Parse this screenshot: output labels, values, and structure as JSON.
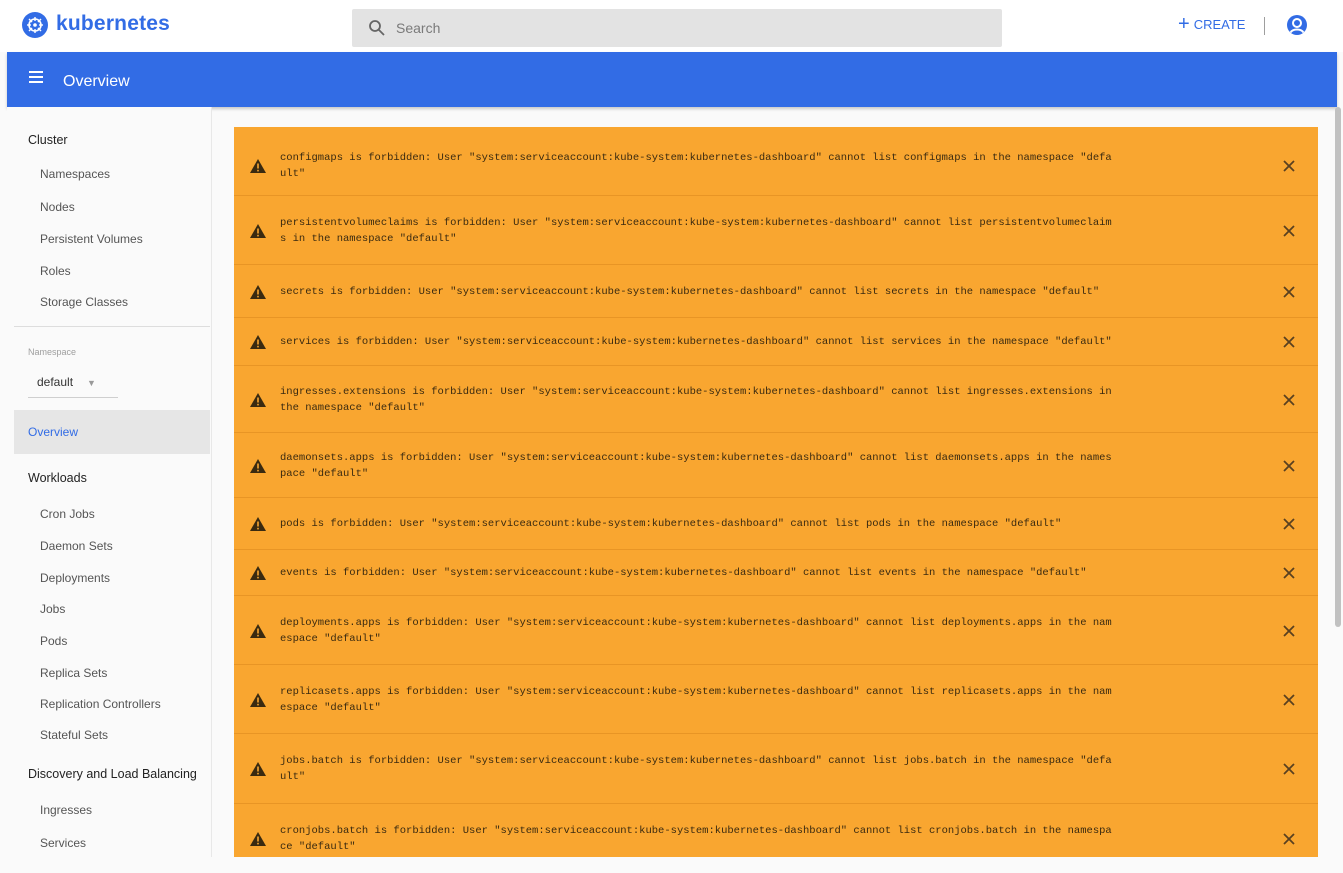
{
  "app": {
    "brand": "kubernetes"
  },
  "header": {
    "search_placeholder": "Search",
    "create_label": "CREATE",
    "plus_glyph": "+"
  },
  "toolbar": {
    "title": "Overview"
  },
  "sidebar": {
    "cluster_heading": "Cluster",
    "cluster_items": [
      "Namespaces",
      "Nodes",
      "Persistent Volumes",
      "Roles",
      "Storage Classes"
    ],
    "namespace_label": "Namespace",
    "namespace_value": "default",
    "overview": "Overview",
    "workloads_heading": "Workloads",
    "workload_items": [
      "Cron Jobs",
      "Daemon Sets",
      "Deployments",
      "Jobs",
      "Pods",
      "Replica Sets",
      "Replication Controllers",
      "Stateful Sets"
    ],
    "discovery_heading": "Discovery and Load Balancing",
    "discovery_items": [
      "Ingresses",
      "Services"
    ]
  },
  "alerts": [
    {
      "lines": [
        "configmaps is forbidden: User \"system:serviceaccount:kube-system:kubernetes-dashboard\" cannot list configmaps in the namespace \"defa",
        "ult\""
      ]
    },
    {
      "lines": [
        "persistentvolumeclaims is forbidden: User \"system:serviceaccount:kube-system:kubernetes-dashboard\" cannot list persistentvolumeclaim",
        "s in the namespace \"default\""
      ]
    },
    {
      "lines": [
        "secrets is forbidden: User \"system:serviceaccount:kube-system:kubernetes-dashboard\" cannot list secrets in the namespace \"default\""
      ]
    },
    {
      "lines": [
        "services is forbidden: User \"system:serviceaccount:kube-system:kubernetes-dashboard\" cannot list services in the namespace \"default\""
      ]
    },
    {
      "lines": [
        "ingresses.extensions is forbidden: User \"system:serviceaccount:kube-system:kubernetes-dashboard\" cannot list ingresses.extensions in",
        "the namespace \"default\""
      ]
    },
    {
      "lines": [
        "daemonsets.apps is forbidden: User \"system:serviceaccount:kube-system:kubernetes-dashboard\" cannot list daemonsets.apps in the names",
        "pace \"default\""
      ]
    },
    {
      "lines": [
        "pods is forbidden: User \"system:serviceaccount:kube-system:kubernetes-dashboard\" cannot list pods in the namespace \"default\""
      ]
    },
    {
      "lines": [
        "events is forbidden: User \"system:serviceaccount:kube-system:kubernetes-dashboard\" cannot list events in the namespace \"default\""
      ]
    },
    {
      "lines": [
        "deployments.apps is forbidden: User \"system:serviceaccount:kube-system:kubernetes-dashboard\" cannot list deployments.apps in the nam",
        "espace \"default\""
      ]
    },
    {
      "lines": [
        "replicasets.apps is forbidden: User \"system:serviceaccount:kube-system:kubernetes-dashboard\" cannot list replicasets.apps in the nam",
        "espace \"default\""
      ]
    },
    {
      "lines": [
        "jobs.batch is forbidden: User \"system:serviceaccount:kube-system:kubernetes-dashboard\" cannot list jobs.batch in the namespace \"defa",
        "ult\""
      ]
    },
    {
      "lines": [
        "cronjobs.batch is forbidden: User \"system:serviceaccount:kube-system:kubernetes-dashboard\" cannot list cronjobs.batch in the namespa",
        "ce \"default\""
      ]
    }
  ],
  "icons": {
    "search": "search-icon",
    "help": "help-icon",
    "menu": "hamburger-menu-icon",
    "warning": "warning-icon",
    "close": "close-icon",
    "caret": "chevron-down-icon"
  },
  "colors": {
    "brand_blue": "#326ce5",
    "alert_bg": "#f9a630",
    "active_nav_bg": "#e6e6e6"
  }
}
